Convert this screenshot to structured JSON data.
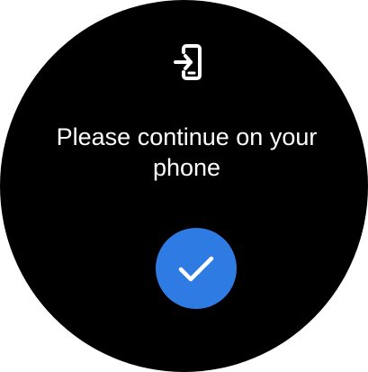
{
  "screen": {
    "message": "Please continue on your phone"
  },
  "icons": {
    "top": "phone-login-icon",
    "confirm": "check-icon"
  },
  "colors": {
    "background": "#000000",
    "text": "#ffffff",
    "accent": "#2f7be4",
    "icon": "#ffffff"
  }
}
